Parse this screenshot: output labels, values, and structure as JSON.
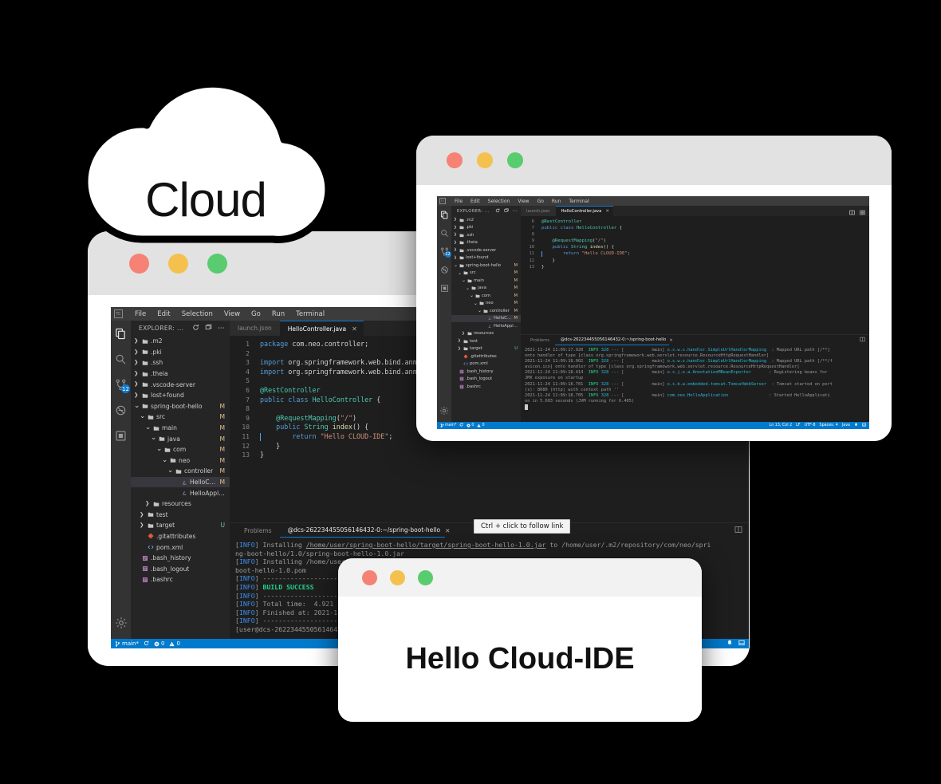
{
  "cloud": {
    "label": "Cloud"
  },
  "window_controls": {
    "close": "close",
    "minimize": "minimize",
    "zoom": "zoom"
  },
  "ide": {
    "menu": [
      "File",
      "Edit",
      "Selection",
      "View",
      "Go",
      "Run",
      "Terminal"
    ],
    "logo": "TC",
    "activity_bar": {
      "icons": [
        "explorer-icon",
        "search-icon",
        "source-control-icon",
        "run-debug-icon",
        "extensions-icon"
      ],
      "source_control_badge": "12",
      "settings_icon": "gear-icon"
    },
    "explorer": {
      "title": "EXPLORER: ...",
      "actions": [
        "refresh-icon",
        "new-folder-icon",
        "more-actions-icon"
      ],
      "tree": [
        {
          "label": ".m2",
          "type": "folder",
          "depth": 0,
          "state": "collapsed",
          "git": ""
        },
        {
          "label": ".pki",
          "type": "folder",
          "depth": 0,
          "state": "collapsed",
          "git": ""
        },
        {
          "label": ".ssh",
          "type": "folder",
          "depth": 0,
          "state": "collapsed",
          "git": ""
        },
        {
          "label": ".theia",
          "type": "folder",
          "depth": 0,
          "state": "collapsed",
          "git": ""
        },
        {
          "label": ".vscode-server",
          "type": "folder",
          "depth": 0,
          "state": "collapsed",
          "git": ""
        },
        {
          "label": "lost+found",
          "type": "folder",
          "depth": 0,
          "state": "collapsed",
          "git": ""
        },
        {
          "label": "spring-boot-hello",
          "type": "folder",
          "depth": 0,
          "state": "expanded",
          "git": "M"
        },
        {
          "label": "src",
          "type": "folder",
          "depth": 1,
          "state": "expanded",
          "git": "M"
        },
        {
          "label": "main",
          "type": "folder",
          "depth": 2,
          "state": "expanded",
          "git": "M"
        },
        {
          "label": "java",
          "type": "folder",
          "depth": 3,
          "state": "expanded",
          "git": "M"
        },
        {
          "label": "com",
          "type": "folder",
          "depth": 4,
          "state": "expanded",
          "git": "M"
        },
        {
          "label": "neo",
          "type": "folder",
          "depth": 5,
          "state": "expanded",
          "git": "M"
        },
        {
          "label": "controller",
          "type": "folder",
          "depth": 6,
          "state": "expanded",
          "git": "M"
        },
        {
          "label": "HelloContr...",
          "type": "java",
          "depth": 7,
          "state": "file",
          "git": "M",
          "selected": true
        },
        {
          "label": "HelloApplicatio...",
          "type": "java",
          "depth": 7,
          "state": "file",
          "git": ""
        },
        {
          "label": "resources",
          "type": "folder",
          "depth": 2,
          "state": "collapsed",
          "git": ""
        },
        {
          "label": "test",
          "type": "folder",
          "depth": 1,
          "state": "collapsed",
          "git": ""
        },
        {
          "label": "target",
          "type": "folder",
          "depth": 1,
          "state": "collapsed",
          "git": "U"
        },
        {
          "label": ".gitattributes",
          "type": "git",
          "depth": 1,
          "state": "file",
          "git": ""
        },
        {
          "label": "pom.xml",
          "type": "xml",
          "depth": 1,
          "state": "file",
          "git": ""
        },
        {
          "label": ".bash_history",
          "type": "text",
          "depth": 0,
          "state": "file",
          "git": ""
        },
        {
          "label": ".bash_logout",
          "type": "text",
          "depth": 0,
          "state": "file",
          "git": ""
        },
        {
          "label": ".bashrc",
          "type": "text",
          "depth": 0,
          "state": "file",
          "git": ""
        }
      ]
    },
    "tabs": [
      {
        "label": "launch.json",
        "active": false,
        "closable": false
      },
      {
        "label": "HelloController.java",
        "active": true,
        "closable": true,
        "close_icon": "close-icon"
      }
    ],
    "editor": {
      "filename": "HelloController.java",
      "line_numbers": [
        "1",
        "2",
        "3",
        "4",
        "5",
        "6",
        "7",
        "8",
        "9",
        "10",
        "11",
        "12",
        "13"
      ],
      "lines": [
        {
          "n": 1,
          "tokens": [
            {
              "t": "package ",
              "c": "kw"
            },
            {
              "t": "com.neo.controller;",
              "c": "pl"
            }
          ]
        },
        {
          "n": 2,
          "tokens": []
        },
        {
          "n": 3,
          "tokens": [
            {
              "t": "import ",
              "c": "kw"
            },
            {
              "t": "org.springframework.web.bind.anno",
              "c": "pl"
            }
          ]
        },
        {
          "n": 4,
          "tokens": [
            {
              "t": "import ",
              "c": "kw"
            },
            {
              "t": "org.springframework.web.bind.anno",
              "c": "pl"
            }
          ]
        },
        {
          "n": 5,
          "tokens": []
        },
        {
          "n": 6,
          "tokens": [
            {
              "t": "@RestController",
              "c": "ann"
            }
          ]
        },
        {
          "n": 7,
          "tokens": [
            {
              "t": "public class ",
              "c": "kw"
            },
            {
              "t": "HelloController",
              "c": "type"
            },
            {
              "t": " {",
              "c": "pl"
            }
          ]
        },
        {
          "n": 8,
          "tokens": []
        },
        {
          "n": 9,
          "tokens": [
            {
              "t": "    @RequestMapping",
              "c": "ann"
            },
            {
              "t": "(",
              "c": "pl"
            },
            {
              "t": "\"/\"",
              "c": "str"
            },
            {
              "t": ")",
              "c": "pl"
            }
          ]
        },
        {
          "n": 10,
          "tokens": [
            {
              "t": "    public ",
              "c": "kw"
            },
            {
              "t": "String ",
              "c": "type"
            },
            {
              "t": "index",
              "c": "fn"
            },
            {
              "t": "() {",
              "c": "pl"
            }
          ]
        },
        {
          "n": 11,
          "tokens": [
            {
              "t": "        return ",
              "c": "kw"
            },
            {
              "t": "\"Hello CLOUD-IDE\"",
              "c": "str"
            },
            {
              "t": ";",
              "c": "pl"
            }
          ]
        },
        {
          "n": 12,
          "tokens": [
            {
              "t": "    }",
              "c": "pl"
            }
          ]
        },
        {
          "n": 13,
          "tokens": [
            {
              "t": "}",
              "c": "pl"
            }
          ]
        }
      ],
      "cursor_line": 11
    },
    "panel": {
      "tabs": [
        {
          "label": "Problems",
          "active": false
        },
        {
          "label": "@dcs-262234455056146432-0:~/spring-boot-hello",
          "active": true,
          "close_icon": "close-icon"
        }
      ],
      "split_icon": "split-terminal-icon",
      "tooltip": "Ctrl + click to follow link",
      "terminal_lines_window1": [
        [
          {
            "t": "[",
            "c": "dim"
          },
          {
            "t": "INFO",
            "c": "info"
          },
          {
            "t": "] Installing ",
            "c": "dim"
          },
          {
            "t": "/home/user/spring-boot-hello/target/spring-boot-hello-1.0.jar",
            "c": "link"
          },
          {
            "t": " to /home/user/.m2/repository/com/neo/spri",
            "c": "dim"
          }
        ],
        [
          {
            "t": "ng-boot-hello/1.0/spring-boot-hello-1.0.jar",
            "c": "dim"
          }
        ],
        [
          {
            "t": "[",
            "c": "dim"
          },
          {
            "t": "INFO",
            "c": "info"
          },
          {
            "t": "] Installing /home/user/spring-boot-hello/pom.xml to /home/user/.m2/repository/com/neo/spring-",
            "c": "dim"
          }
        ],
        [
          {
            "t": "boot-hello-1.0.pom",
            "c": "dim"
          }
        ],
        [
          {
            "t": "[",
            "c": "dim"
          },
          {
            "t": "INFO",
            "c": "info"
          },
          {
            "t": "] ------------------------------------------------------------------------",
            "c": "dim"
          }
        ],
        [
          {
            "t": "[",
            "c": "dim"
          },
          {
            "t": "INFO",
            "c": "info"
          },
          {
            "t": "] ",
            "c": "dim"
          },
          {
            "t": "BUILD SUCCESS",
            "c": "ok"
          }
        ],
        [
          {
            "t": "[",
            "c": "dim"
          },
          {
            "t": "INFO",
            "c": "info"
          },
          {
            "t": "] ------------------------------------------------------------------------",
            "c": "dim"
          }
        ],
        [
          {
            "t": "[",
            "c": "dim"
          },
          {
            "t": "INFO",
            "c": "info"
          },
          {
            "t": "] Total time:  4.921 s",
            "c": "dim"
          }
        ],
        [
          {
            "t": "[",
            "c": "dim"
          },
          {
            "t": "INFO",
            "c": "info"
          },
          {
            "t": "] Finished at: 2021-11-24T11:09:05+08:00",
            "c": "dim"
          }
        ],
        [
          {
            "t": "[",
            "c": "dim"
          },
          {
            "t": "INFO",
            "c": "info"
          },
          {
            "t": "] ------------------------------------------------------------------------",
            "c": "dim"
          }
        ],
        [
          {
            "t": "[user@dcs-262234455056146432-0 spring-boot-hello]$ ",
            "c": "dim"
          }
        ]
      ],
      "terminal_lines_window2": [
        [
          {
            "t": "2021-11-24 11:09:17.920  ",
            "c": "dim"
          },
          {
            "t": "INFO",
            "c": "green"
          },
          {
            "t": " ",
            "c": "dim"
          },
          {
            "t": "328",
            "c": "cyan"
          },
          {
            "t": " --- [           main] ",
            "c": "dim"
          },
          {
            "t": "o.s.w.s.handler.SimpleUrlHandlerMapping",
            "c": "cyan"
          },
          {
            "t": "  : Mapped URL path [/**]",
            "c": "dim"
          }
        ],
        [
          {
            "t": "onto handler of type [class org.springframework.web.servlet.resource.ResourceHttpRequestHandler]",
            "c": "dim"
          }
        ],
        [
          {
            "t": "2021-11-24 11:09:18.002  ",
            "c": "dim"
          },
          {
            "t": "INFO",
            "c": "green"
          },
          {
            "t": " ",
            "c": "dim"
          },
          {
            "t": "328",
            "c": "cyan"
          },
          {
            "t": " --- [           main] ",
            "c": "dim"
          },
          {
            "t": "o.s.w.s.handler.SimpleUrlHandlerMapping",
            "c": "cyan"
          },
          {
            "t": "  : Mapped URL path [/**/f",
            "c": "dim"
          }
        ],
        [
          {
            "t": "avicon.ico] onto handler of type [class org.springframework.web.servlet.resource.ResourceHttpRequestHandler]",
            "c": "dim"
          }
        ],
        [
          {
            "t": "2021-11-24 11:09:18.414  ",
            "c": "dim"
          },
          {
            "t": "INFO",
            "c": "green"
          },
          {
            "t": " ",
            "c": "dim"
          },
          {
            "t": "328",
            "c": "cyan"
          },
          {
            "t": " --- [           main] ",
            "c": "dim"
          },
          {
            "t": "o.s.j.e.a.AnnotationMBeanExporter",
            "c": "cyan"
          },
          {
            "t": "       : Registering beans for",
            "c": "dim"
          }
        ],
        [
          {
            "t": "JMX exposure on startup",
            "c": "dim"
          }
        ],
        [
          {
            "t": "2021-11-24 11:09:18.701  ",
            "c": "dim"
          },
          {
            "t": "INFO",
            "c": "green"
          },
          {
            "t": " ",
            "c": "dim"
          },
          {
            "t": "328",
            "c": "cyan"
          },
          {
            "t": " --- [           main] ",
            "c": "dim"
          },
          {
            "t": "o.s.b.w.embedded.tomcat.TomcatWebServer",
            "c": "cyan"
          },
          {
            "t": "  : Tomcat started on port",
            "c": "dim"
          }
        ],
        [
          {
            "t": "(s): 8080 (http) with context path ''",
            "c": "dim"
          }
        ],
        [
          {
            "t": "2021-11-24 11:09:18.705  ",
            "c": "dim"
          },
          {
            "t": "INFO",
            "c": "green"
          },
          {
            "t": " ",
            "c": "dim"
          },
          {
            "t": "328",
            "c": "cyan"
          },
          {
            "t": " --- [           main] ",
            "c": "dim"
          },
          {
            "t": "com.neo.HelloApplication",
            "c": "cyan"
          },
          {
            "t": "                : Started HelloApplicati",
            "c": "dim"
          }
        ],
        [
          {
            "t": "on in 5.603 seconds (JVM running for 6.405)",
            "c": "dim"
          }
        ]
      ]
    },
    "statusbar": {
      "branch_icon": "source-control-branch-icon",
      "branch": "main*",
      "sync_icon": "sync-icon",
      "error_icon": "error-icon",
      "errors": "0",
      "warning_icon": "warning-icon",
      "warnings": "0",
      "right_items": [
        "Ln 13, Col 2",
        "LF",
        "UTF-8",
        "Spaces: 4",
        "Java"
      ],
      "bell_icon": "bell-icon",
      "layout_icon": "panel-layout-icon"
    }
  },
  "preview": {
    "heading": "Hello Cloud-IDE"
  },
  "colors": {
    "accent_blue": "#007acc",
    "titlebar": "#e2e2e2",
    "editor_bg": "#1e1e1e",
    "sidebar_bg": "#252526",
    "activitybar_bg": "#333333",
    "menubar_bg": "#3c3c3c",
    "dot_red": "#f58274",
    "dot_yellow": "#f4c14f",
    "dot_green": "#58cc6e",
    "git_modified": "#e2c08d",
    "git_untracked": "#73c991",
    "build_success": "#23d18b",
    "page_bg": "#000000"
  }
}
